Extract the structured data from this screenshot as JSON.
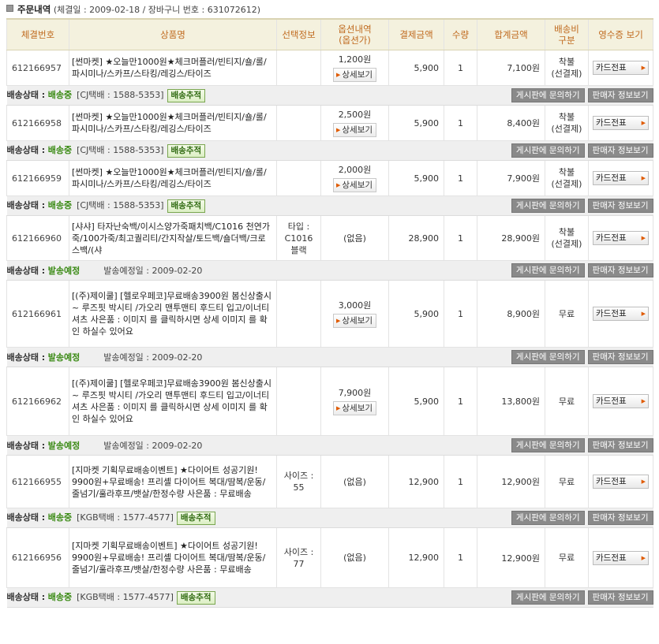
{
  "header": {
    "title": "주문내역",
    "meta": "(체결일 : 2009-02-18 / 장바구니 번호 : 631072612)"
  },
  "columns": {
    "order_no": "체결번호",
    "product": "상품명",
    "select_info": "선택정보",
    "options_l1": "옵션내역",
    "options_l2": "(옵션가)",
    "paid": "결제금액",
    "qty": "수량",
    "total": "합계금액",
    "ship_l1": "배송비",
    "ship_l2": "구분",
    "receipt": "영수증 보기"
  },
  "buttons": {
    "detail": "상세보기",
    "card": "카드전표",
    "track": "배송추적",
    "board_inquiry": "게시판에 문의하기",
    "seller_info": "판매자 정보보기"
  },
  "status_label": "배송상태 :",
  "orders": [
    {
      "order_no": "612166957",
      "product": "[썬마켓] ★오늘만1000원★체크머플러/빈티지/숄/롤/파시미나/스카프/스타킹/레깅스/타이즈",
      "select_info": "",
      "option_price": "1,200원",
      "paid": "5,900",
      "qty": "1",
      "total": "7,100원",
      "ship_l1": "착불",
      "ship_l2": "(선결제)",
      "status": "배송중",
      "courier": "[CJ택배 : 1588-5353]",
      "ship_date": ""
    },
    {
      "order_no": "612166958",
      "product": "[썬마켓] ★오늘만1000원★체크머플러/빈티지/숄/롤/파시미나/스카프/스타킹/레깅스/타이즈",
      "select_info": "",
      "option_price": "2,500원",
      "paid": "5,900",
      "qty": "1",
      "total": "8,400원",
      "ship_l1": "착불",
      "ship_l2": "(선결제)",
      "status": "배송중",
      "courier": "[CJ택배 : 1588-5353]",
      "ship_date": ""
    },
    {
      "order_no": "612166959",
      "product": "[썬마켓] ★오늘만1000원★체크머플러/빈티지/숄/롤/파시미나/스카프/스타킹/레깅스/타이즈",
      "select_info": "",
      "option_price": "2,000원",
      "paid": "5,900",
      "qty": "1",
      "total": "7,900원",
      "ship_l1": "착불",
      "ship_l2": "(선결제)",
      "status": "배송중",
      "courier": "[CJ택배 : 1588-5353]",
      "ship_date": ""
    },
    {
      "order_no": "612166960",
      "product": "[샤샤] 타자난숙백/이시스양가죽패치백/C1016 천연가죽/100가죽/최고퀄리티/간지작살/토드백/숄더백/크로스백/(샤",
      "select_info": "타입 : C1016 블랙",
      "option_price": "(없음)",
      "paid": "28,900",
      "qty": "1",
      "total": "28,900원",
      "ship_l1": "착불",
      "ship_l2": "(선결제)",
      "status": "발송예정",
      "courier": "",
      "ship_date": "발송예정일 : 2009-02-20"
    },
    {
      "order_no": "612166961",
      "product": "[(주)제이쿨] [헬로우페코]무료배송3900원 봄신상출시~ 루즈핏 박시티 /가오리 맨투맨티 후드티 입고/이너티셔츠 사은품 : 이미지 를 클릭하시면 상세 이미지 를 확인 하실수 있어요",
      "select_info": "",
      "option_price": "3,000원",
      "paid": "5,900",
      "qty": "1",
      "total": "8,900원",
      "ship_l1": "무료",
      "ship_l2": "",
      "status": "발송예정",
      "courier": "",
      "ship_date": "발송예정일 : 2009-02-20"
    },
    {
      "order_no": "612166962",
      "product": "[(주)제이쿨] [헬로우페코]무료배송3900원 봄신상출시~ 루즈핏 박시티 /가오리 맨투맨티 후드티 입고/이너티셔츠 사은품 : 이미지 를 클릭하시면 상세 이미지 를 확인 하실수 있어요",
      "select_info": "",
      "option_price": "7,900원",
      "paid": "5,900",
      "qty": "1",
      "total": "13,800원",
      "ship_l1": "무료",
      "ship_l2": "",
      "status": "발송예정",
      "courier": "",
      "ship_date": "발송예정일 : 2009-02-20"
    },
    {
      "order_no": "612166955",
      "product": "[지마켓 기획무료배송이벤트] ★다이어트 성공기원! 9900원+무료배송! 프리셸 다이어트 복대/땀복/운동/줄넘기/훌라후프/뱃살/한정수량 사은품 : 무료배송",
      "select_info": "사이즈 : 55",
      "option_price": "(없음)",
      "paid": "12,900",
      "qty": "1",
      "total": "12,900원",
      "ship_l1": "무료",
      "ship_l2": "",
      "status": "배송중",
      "courier": "[KGB택배 : 1577-4577]",
      "ship_date": ""
    },
    {
      "order_no": "612166956",
      "product": "[지마켓 기획무료배송이벤트] ★다이어트 성공기원! 9900원+무료배송! 프리셸 다이어트 복대/땀복/운동/줄넘기/훌라후프/뱃살/한정수량 사은품 : 무료배송",
      "select_info": "사이즈 : 77",
      "option_price": "(없음)",
      "paid": "12,900",
      "qty": "1",
      "total": "12,900원",
      "ship_l1": "무료",
      "ship_l2": "",
      "status": "배송중",
      "courier": "[KGB택배 : 1577-4577]",
      "ship_date": ""
    }
  ]
}
